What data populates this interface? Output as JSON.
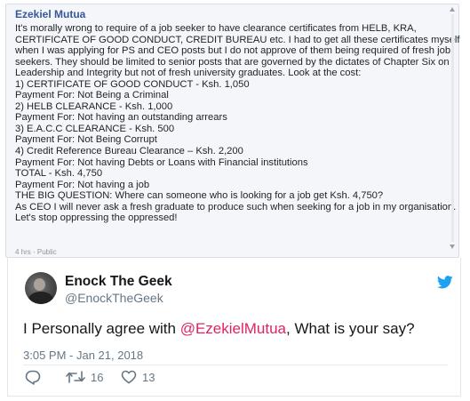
{
  "facebook_post": {
    "author": "Ezekiel Mutua",
    "lines": [
      "It's morally wrong to require of a job seeker to have clearance certificates from HELB, KRA,",
      "CERTIFICATE OF GOOD CONDUCT, CREDIT BUREAU etc. I had to get all these certificates myself",
      "when I was applying for PS and CEO posts but I do not approve of them being required of fresh job",
      "seekers. They should be limited to senior posts that are governed by the dictates of Chapter Six on",
      "Leadership and Integrity but not of fresh university graduates. Look at the cost:",
      "1) CERTIFICATE OF GOOD CONDUCT - Ksh. 1,050",
      "Payment For: Not Being a Criminal",
      "2) HELB CLEARANCE - Ksh. 1,000",
      "Payment For: Not having an outstanding arrears",
      "3) E.A.C.C CLEARANCE - Ksh. 500",
      "Payment For: Not Being Corrupt",
      "4) Credit Reference Bureau Clearance – Ksh. 2,200",
      "Payment For: Not having Debts or Loans with Financial institutions",
      "TOTAL - Ksh. 4,750",
      "Payment For: Not having a job",
      "THE BIG QUESTION: Where can someone who is looking for a job get Ksh. 4,750?",
      "As CEO I will never ask a fresh graduate to produce such when seeking for a job in my organisation.",
      "Let's stop oppressing the oppressed!"
    ],
    "meta": "4 hrs · Public"
  },
  "tweet": {
    "display_name": "Enock The Geek",
    "handle": "@EnockTheGeek",
    "text_before": "I Personally agree with ",
    "mention": "@EzekielMutua",
    "text_after": ", What is your say?",
    "timestamp": "3:05 PM - Jan 21, 2018",
    "retweets": "16",
    "likes": "13"
  },
  "icons": {
    "brand": "twitter-bird-icon",
    "reply": "reply-icon",
    "retweet": "retweet-icon",
    "like": "heart-icon"
  },
  "colors": {
    "twitter_blue": "#1da1f2",
    "mention": "#e0245e",
    "fb_name": "#365899"
  }
}
